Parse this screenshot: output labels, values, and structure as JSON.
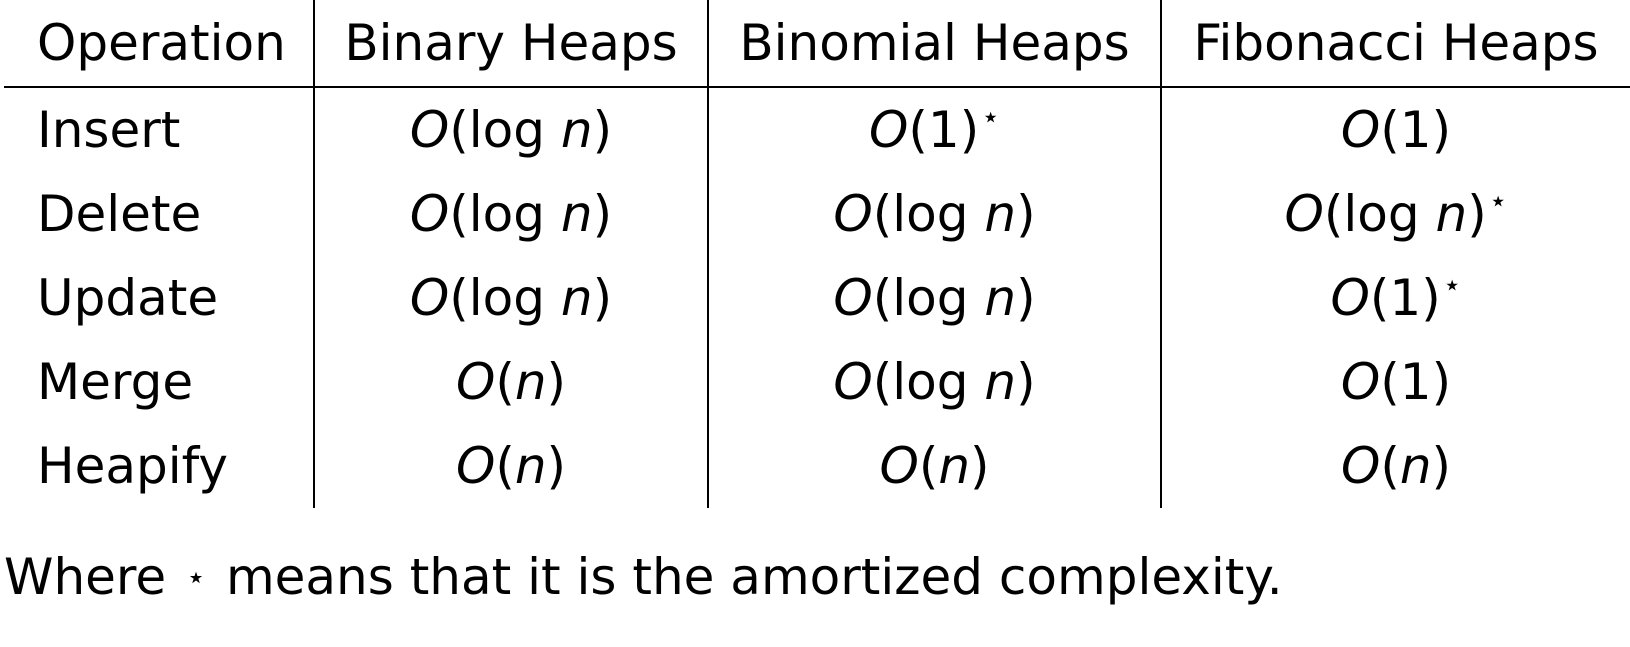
{
  "table": {
    "headers": [
      "Operation",
      "Binary Heaps",
      "Binomial Heaps",
      "Fibonacci Heaps"
    ],
    "rows": [
      {
        "operation": "Insert",
        "cells": [
          {
            "O": "O",
            "arg": "log",
            "var": "n",
            "star": false
          },
          {
            "O": "O",
            "arg": "1",
            "var": "",
            "star": true
          },
          {
            "O": "O",
            "arg": "1",
            "var": "",
            "star": false
          }
        ]
      },
      {
        "operation": "Delete",
        "cells": [
          {
            "O": "O",
            "arg": "log",
            "var": "n",
            "star": false
          },
          {
            "O": "O",
            "arg": "log",
            "var": "n",
            "star": false
          },
          {
            "O": "O",
            "arg": "log",
            "var": "n",
            "star": true
          }
        ]
      },
      {
        "operation": "Update",
        "cells": [
          {
            "O": "O",
            "arg": "log",
            "var": "n",
            "star": false
          },
          {
            "O": "O",
            "arg": "log",
            "var": "n",
            "star": false
          },
          {
            "O": "O",
            "arg": "1",
            "var": "",
            "star": true
          }
        ]
      },
      {
        "operation": "Merge",
        "cells": [
          {
            "O": "O",
            "arg": "",
            "var": "n",
            "star": false
          },
          {
            "O": "O",
            "arg": "log",
            "var": "n",
            "star": false
          },
          {
            "O": "O",
            "arg": "1",
            "var": "",
            "star": false
          }
        ]
      },
      {
        "operation": "Heapify",
        "cells": [
          {
            "O": "O",
            "arg": "",
            "var": "n",
            "star": false
          },
          {
            "O": "O",
            "arg": "",
            "var": "n",
            "star": false
          },
          {
            "O": "O",
            "arg": "",
            "var": "n",
            "star": false
          }
        ]
      }
    ]
  },
  "footnote": {
    "before": "Where",
    "symbol": "⋆",
    "after": "means that it is the amortized complexity."
  }
}
